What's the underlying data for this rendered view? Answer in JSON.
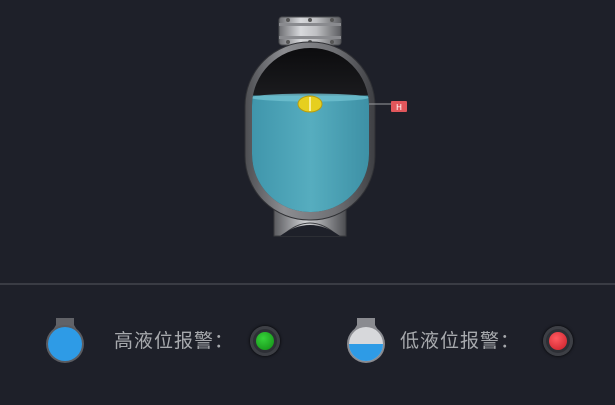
{
  "tank": {
    "level_marker": "H",
    "fill_level": 0.71
  },
  "alarms": {
    "high": {
      "label": "高液位报警：",
      "icon": "flask-high-level-icon",
      "lamp_state": "normal",
      "lamp_color": "#17a21a"
    },
    "low": {
      "label": "低液位报警：",
      "icon": "flask-low-level-icon",
      "lamp_state": "alarm",
      "lamp_color": "#e2303a"
    }
  },
  "colors": {
    "background": "#1e2029",
    "liquid": "#4aa3b8",
    "flask_liquid": "#2e9be6",
    "marker": "#e0565b"
  }
}
